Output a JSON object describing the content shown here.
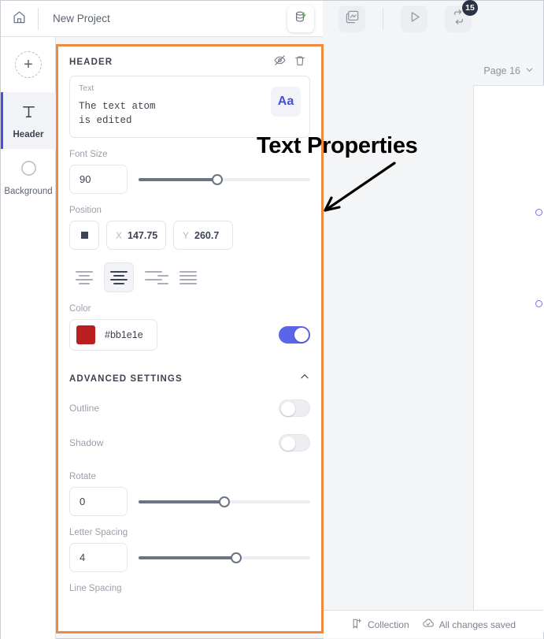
{
  "topbar": {
    "home_icon": "home-icon",
    "project_title": "New Project",
    "db_icon": "database-bolt-icon",
    "image_icon": "image-chart-icon",
    "play_icon": "play-icon",
    "loop_icon": "repeat-icon",
    "loop_badge": "15"
  },
  "rail": {
    "add_label": "+",
    "items": [
      {
        "label": "Header",
        "icon": "text-t-icon",
        "active": true
      },
      {
        "label": "Background",
        "icon": "circle-icon",
        "active": false
      }
    ]
  },
  "panel": {
    "title": "HEADER",
    "hide_icon": "eye-off-icon",
    "delete_icon": "trash-icon",
    "text_card": {
      "label": "Text",
      "value": "The text atom\nis edited",
      "font_button": "Aa"
    },
    "font_size": {
      "label": "Font Size",
      "value": "90",
      "slider_pct": 46
    },
    "position": {
      "label": "Position",
      "anchor_icon": "anchor-square-icon",
      "x_axis": "X",
      "x_value": "147.75",
      "y_axis": "Y",
      "y_value": "260.7"
    },
    "align": {
      "options": [
        "align-left",
        "align-center",
        "align-right",
        "align-justify"
      ],
      "selected": "align-center"
    },
    "color": {
      "label": "Color",
      "hex": "#bb1e1e",
      "toggle_on": true
    },
    "advanced": {
      "title": "ADVANCED SETTINGS",
      "chevron_icon": "chevron-up-icon",
      "outline": {
        "label": "Outline",
        "on": false
      },
      "shadow": {
        "label": "Shadow",
        "on": false
      },
      "rotate": {
        "label": "Rotate",
        "value": "0",
        "slider_pct": 50
      },
      "letter_spacing": {
        "label": "Letter Spacing",
        "value": "4",
        "slider_pct": 57
      },
      "line_spacing": {
        "label": "Line Spacing"
      }
    }
  },
  "canvas": {
    "page_label": "Page 16",
    "page_chevron": "chevron-down-icon"
  },
  "bottombar": {
    "collection_label": "Collection",
    "collection_icon": "bookmark-plus-icon",
    "saved_label": "All changes saved",
    "saved_icon": "cloud-check-icon"
  },
  "annotation": {
    "text": "Text Properties",
    "arrow_icon": "arrow-pointer-icon"
  },
  "colors": {
    "accent_orange": "#f08a3c",
    "toggle_blue": "#5b65e8",
    "badge_dark": "#2b3245",
    "text_color_swatch": "#bb1e1e"
  }
}
